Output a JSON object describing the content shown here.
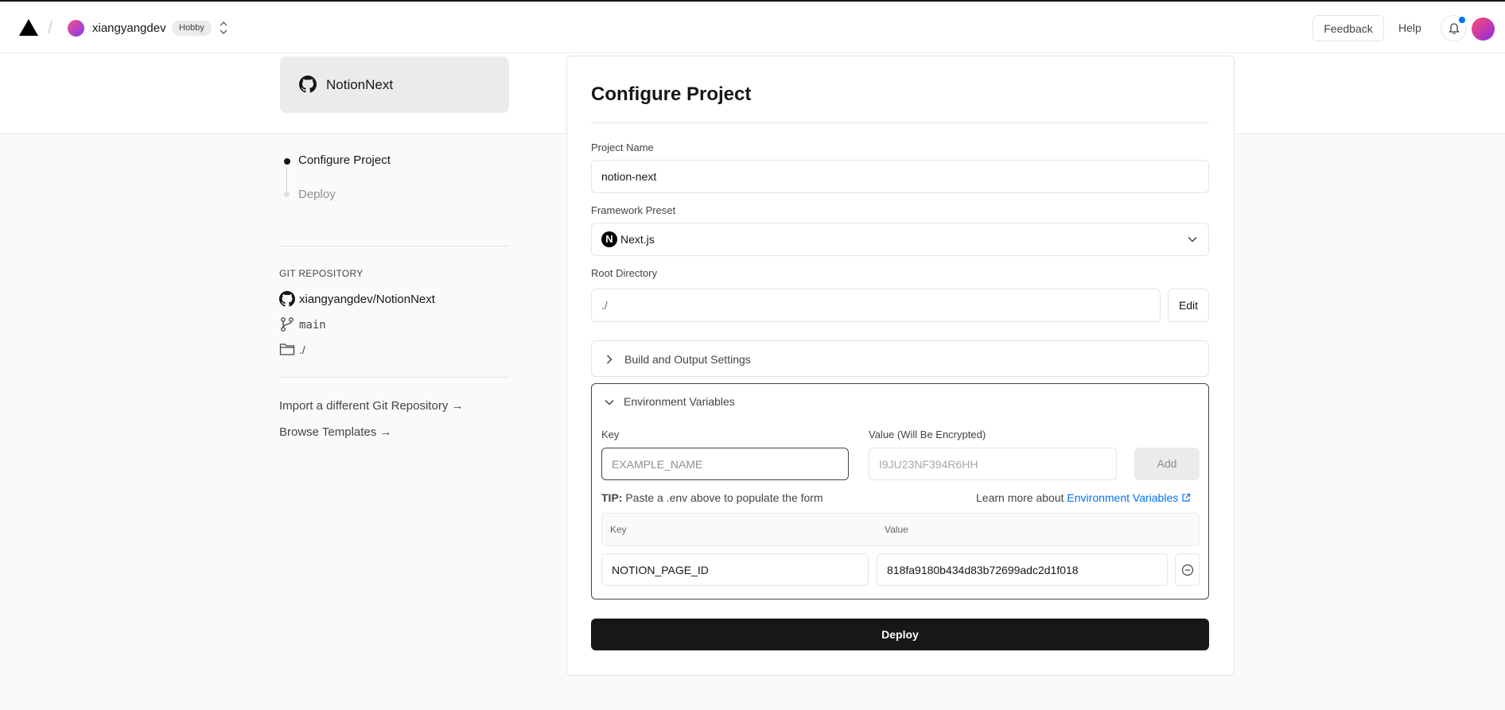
{
  "header": {
    "team_name": "xiangyangdev",
    "plan_badge": "Hobby",
    "feedback_label": "Feedback",
    "help_label": "Help"
  },
  "sidebar": {
    "repo_card_name": "NotionNext",
    "steps": [
      {
        "label": "Configure Project",
        "state": "active"
      },
      {
        "label": "Deploy",
        "state": "pending"
      }
    ],
    "git_section_label": "GIT REPOSITORY",
    "git_repo": "xiangyangdev/NotionNext",
    "git_branch": "main",
    "git_dir": "./",
    "import_link": "Import a different Git Repository →",
    "templates_link": "Browse Templates →"
  },
  "config": {
    "title": "Configure Project",
    "project_name_label": "Project Name",
    "project_name_value": "notion-next",
    "framework_label": "Framework Preset",
    "framework_value": "Next.js",
    "root_dir_label": "Root Directory",
    "root_dir_value": "./",
    "edit_label": "Edit",
    "build_settings_label": "Build and Output Settings",
    "env": {
      "section_label": "Environment Variables",
      "key_label": "Key",
      "value_label": "Value (Will Be Encrypted)",
      "key_placeholder": "EXAMPLE_NAME",
      "value_placeholder": "I9JU23NF394R6HH",
      "add_label": "Add",
      "tip_bold": "TIP:",
      "tip_text": "Paste a .env above to populate the form",
      "learn_prefix": "Learn more about",
      "learn_link": "Environment Variables",
      "table_key_header": "Key",
      "table_value_header": "Value",
      "rows": [
        {
          "key": "NOTION_PAGE_ID",
          "value": "818fa9180b434d83b72699adc2d1f018"
        }
      ]
    },
    "deploy_label": "Deploy"
  },
  "colors": {
    "accent": "#0070f3",
    "primary_button": "#171717"
  }
}
